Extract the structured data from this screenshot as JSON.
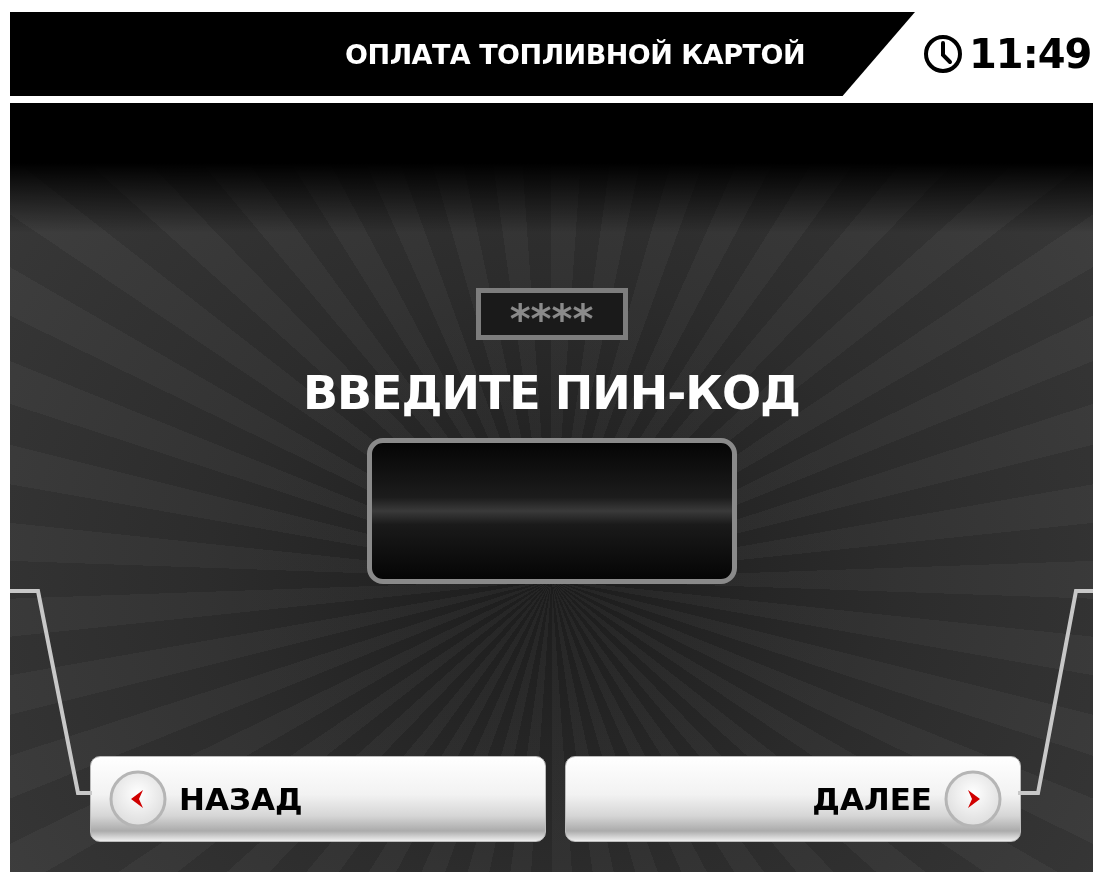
{
  "header": {
    "title": "ОПЛАТА ТОПЛИВНОЙ КАРТОЙ",
    "time": "11:49"
  },
  "pin_mask": "****",
  "prompt": "ВВЕДИТЕ ПИН-КОД",
  "buttons": [
    {
      "label": "НАЗАД",
      "kind": "back"
    },
    {
      "label": "ДАЛЕЕ",
      "kind": "next"
    }
  ]
}
